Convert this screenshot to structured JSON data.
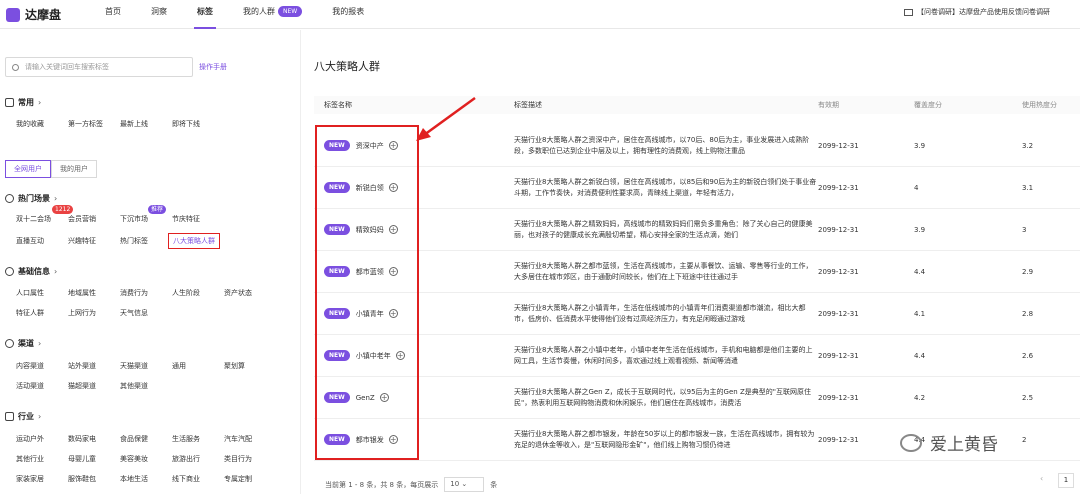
{
  "brand": {
    "name": "达摩盘"
  },
  "nav": {
    "items": [
      {
        "label": "首页",
        "active": false,
        "badge": ""
      },
      {
        "label": "洞察",
        "active": false,
        "badge": ""
      },
      {
        "label": "标签",
        "active": true,
        "badge": ""
      },
      {
        "label": "我的人群",
        "active": false,
        "badge": "NEW"
      },
      {
        "label": "我的报表",
        "active": false,
        "badge": ""
      }
    ]
  },
  "notice": "【问卷调研】达摩盘产品使用反馈问卷调研",
  "sidebar": {
    "search_placeholder": "请输入关键词回车搜索标签",
    "manual": "操作手册",
    "common": {
      "title": "常用",
      "items": [
        "我的收藏",
        "第一方标签",
        "最新上线",
        "即将下线"
      ]
    },
    "segment": [
      "全网用户",
      "我的用户"
    ],
    "hot": {
      "title": "热门场景",
      "row1": [
        "双十二会场",
        "会员营销",
        "下沉市场",
        "节庆特征"
      ],
      "row2": [
        "直播互动",
        "兴趣特征",
        "热门标签",
        "八大策略人群"
      ],
      "count_badge": "1212",
      "hot_badge": "推荐"
    },
    "basic": {
      "title": "基础信息",
      "row1": [
        "人口属性",
        "地域属性",
        "消费行为",
        "人生阶段",
        "资产状态"
      ],
      "row2": [
        "特征人群",
        "上网行为",
        "天气信息"
      ]
    },
    "channel": {
      "title": "渠道",
      "row1": [
        "内容渠道",
        "站外渠道",
        "天猫渠道",
        "通用",
        "聚划算"
      ],
      "row2": [
        "活动渠道",
        "猫超渠道",
        "其他渠道"
      ]
    },
    "industry": {
      "title": "行业",
      "row1": [
        "运动户外",
        "数码家电",
        "食品保健",
        "生活服务",
        "汽车汽配"
      ],
      "row2": [
        "其他行业",
        "母婴儿童",
        "美容美妆",
        "旅游出行",
        "类目行为"
      ],
      "row3": [
        "家装家居",
        "服饰鞋包",
        "本地生活",
        "线下商业",
        "专属定制"
      ]
    }
  },
  "main": {
    "title": "八大策略人群",
    "columns": [
      "标签名称",
      "标签描述",
      "有效期",
      "覆盖度分",
      "使用热度分"
    ],
    "rows": [
      {
        "name": "资深中产",
        "desc": "天猫行业8大策略人群之资深中产，居住在高线城市，以70后、80后为主，事业发展进入成熟阶段，多数职位已达到企业中层及以上，拥有理性的消费观，线上购物注重品",
        "exp": "2099-12-31",
        "cov": "3.9",
        "heat": "3.2"
      },
      {
        "name": "新锐白领",
        "desc": "天猫行业8大策略人群之新锐白领，居住在高线城市，以85后和90后为主的新锐白领们处于事业奋斗期，工作节奏快，对消费便利性要求高，青睐线上渠道，年轻有活力，",
        "exp": "2099-12-31",
        "cov": "4",
        "heat": "3.1"
      },
      {
        "name": "精致妈妈",
        "desc": "天猫行业8大策略人群之精致妈妈，高线城市的精致妈妈们需负多重角色：除了关心自己的健康美丽，也对孩子的健康成长充满殷切希望，精心安排全家的生活点滴，她们",
        "exp": "2099-12-31",
        "cov": "3.9",
        "heat": "3"
      },
      {
        "name": "都市蓝领",
        "desc": "天猫行业8大策略人群之都市蓝领，生活在高线城市，主要从事餐饮、运输、零售等行业的工作，大多居住在城市郊区，由于通勤时间较长，他们在上下班途中往往通过手",
        "exp": "2099-12-31",
        "cov": "4.4",
        "heat": "2.9"
      },
      {
        "name": "小镇青年",
        "desc": "天猫行业8大策略人群之小镇青年，生活在低线城市的小镇青年们消费渠道都市潮流，相比大都市，低房价、低消费水平使得他们没有过高经济压力，有充足闲暇通过游戏",
        "exp": "2099-12-31",
        "cov": "4.1",
        "heat": "2.8"
      },
      {
        "name": "小镇中老年",
        "desc": "天猫行业8大策略人群之小镇中老年，小镇中老年生活在低线城市，手机和电脑都是他们主要的上网工具，生活节奏慢，休闲时间多，喜欢通过线上观看视频、新闻等消遣",
        "exp": "2099-12-31",
        "cov": "4.4",
        "heat": "2.6"
      },
      {
        "name": "GenZ",
        "desc": "天猫行业8大策略人群之Gen Z，成长于互联网时代，以95后为主的Gen Z是典型的\"互联网原住民\"，热衷利用互联网购物消费和休闲娱乐，他们居住在高线城市，消费活",
        "exp": "2099-12-31",
        "cov": "4.2",
        "heat": "2.5"
      },
      {
        "name": "都市银发",
        "desc": "天猫行业8大策略人群之都市银发，年龄在50岁以上的都市银发一族，生活在高线城市，拥有较为充足的退休金等收入，是\"互联网隐形金矿\"，他们线上购物习惯仍待进",
        "exp": "2099-12-31",
        "cov": "4.4",
        "heat": "2"
      }
    ],
    "new_label": "NEW",
    "footer": {
      "range": "当前第 1 - 8 条，共 8 条，每页展示",
      "size": "10",
      "unit": "条"
    },
    "page": "1"
  },
  "watermark": "爱上黄昏"
}
